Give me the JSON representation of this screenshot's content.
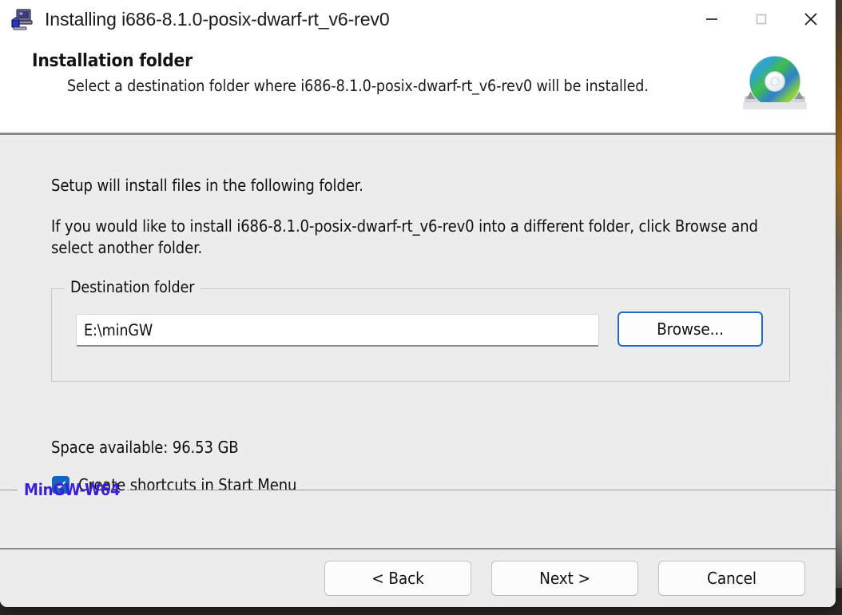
{
  "window": {
    "title": "Installing i686-8.1.0-posix-dwarf-rt_v6-rev0",
    "app_icon": "installer-computer-icon",
    "controls": {
      "minimize": "minimize-icon",
      "maximize": "maximize-icon",
      "close": "close-icon"
    }
  },
  "header": {
    "title": "Installation folder",
    "subtitle": "Select a destination folder where i686-8.1.0-posix-dwarf-rt_v6-rev0 will be installed.",
    "icon": "cd-disc-icon"
  },
  "body": {
    "paragraph1": "Setup will install files in the following folder.",
    "paragraph2": "If you would like to install i686-8.1.0-posix-dwarf-rt_v6-rev0 into a different folder, click Browse and select another folder.",
    "group": {
      "legend": "Destination folder",
      "path_value": "E:\\minGW",
      "path_placeholder": "",
      "browse_label": "Browse..."
    },
    "space_available": "Space available: 96.53 GB",
    "checkbox": {
      "label": "Create shortcuts in Start Menu",
      "checked": true
    }
  },
  "brand": {
    "label": "MinGW-W64"
  },
  "footer": {
    "back_label": "< Back",
    "next_label": "Next >",
    "cancel_label": "Cancel"
  },
  "colors": {
    "accent_blue": "#1a6fc4",
    "checkbox_blue": "#1565c0",
    "brand_purple": "#3b1fd6",
    "body_bg": "#ececec",
    "separator": "#8b8b8b"
  }
}
